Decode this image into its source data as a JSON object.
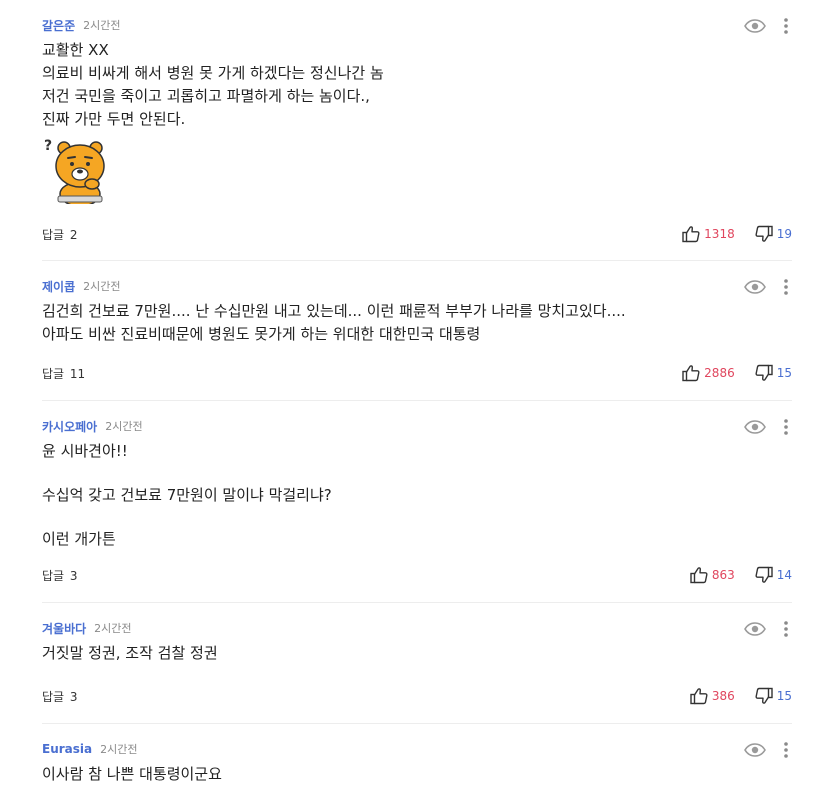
{
  "comments": [
    {
      "author": "갈은준",
      "time": "2시간전",
      "text": "교활한 XX\n의료비 비싸게 해서 병원 못 가게 하겠다는 정신나간 놈\n저건 국민을 죽이고 괴롭히고 파멸하게 하는 놈이다.,\n진짜 가만 두면 안된다.",
      "reply_label": "답글",
      "reply_count": "2",
      "likes": "1318",
      "dislikes": "19",
      "has_emoticon": true
    },
    {
      "author": "제이콥",
      "time": "2시간전",
      "text": "김건희 건보료 7만원.... 난 수십만원 내고 있는데... 이런 패륜적 부부가 나라를 망치고있다....\n아파도 비싼 진료비때문에 병원도 못가게 하는 위대한 대한민국 대통령",
      "reply_label": "답글",
      "reply_count": "11",
      "likes": "2886",
      "dislikes": "15"
    },
    {
      "author": "카시오페아",
      "time": "2시간전",
      "text": "윤 시바견아!!\n\n수십억 갖고 건보료 7만원이 말이냐 막걸리냐?\n\n이런 개가튼",
      "reply_label": "답글",
      "reply_count": "3",
      "likes": "863",
      "dislikes": "14"
    },
    {
      "author": "겨울바다",
      "time": "2시간전",
      "text": "거짓말 정권, 조작 검찰 정권",
      "reply_label": "답글",
      "reply_count": "3",
      "likes": "386",
      "dislikes": "15"
    },
    {
      "author": "Eurasia",
      "time": "2시간전",
      "text": "이사람 참 나쁜 대통령이군요"
    }
  ],
  "icons": {
    "view": "eye-icon",
    "more": "more-vertical-icon",
    "like": "thumbs-up-icon",
    "dislike": "thumbs-down-icon",
    "emoticon": "thinking-bear-emoticon"
  },
  "colors": {
    "author": "#4a6fd1",
    "like_count": "#e0465e",
    "dislike_count": "#4a6fd1",
    "emoticon_body": "#f5a623"
  }
}
